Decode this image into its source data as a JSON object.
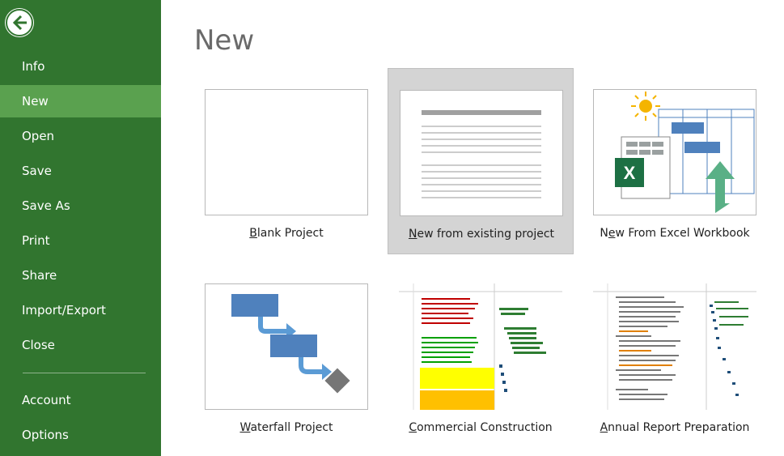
{
  "sidebar": {
    "back_icon": "arrow-left-circle-icon",
    "items": [
      {
        "label": "Info"
      },
      {
        "label": "New",
        "active": true
      },
      {
        "label": "Open"
      },
      {
        "label": "Save"
      },
      {
        "label": "Save As"
      },
      {
        "label": "Print"
      },
      {
        "label": "Share"
      },
      {
        "label": "Import/Export"
      },
      {
        "label": "Close"
      },
      {
        "label": "Account"
      },
      {
        "label": "Options"
      }
    ],
    "colors": {
      "background": "#31752f",
      "active": "#5aa14f"
    }
  },
  "main": {
    "title": "New",
    "templates": [
      {
        "access_key": "B",
        "label_rest": "lank Project",
        "label_pre": ""
      },
      {
        "access_key": "N",
        "label_rest": "ew from existing project",
        "label_pre": "",
        "selected": true
      },
      {
        "access_key": "e",
        "label_pre": "N",
        "label_rest": "w From Excel Workbook"
      },
      {
        "access_key": "W",
        "label_rest": "aterfall Project",
        "label_pre": ""
      },
      {
        "access_key": "C",
        "label_rest": "ommercial Construction",
        "label_pre": ""
      },
      {
        "access_key": "A",
        "label_rest": "nnual Report Preparation",
        "label_pre": ""
      }
    ]
  }
}
